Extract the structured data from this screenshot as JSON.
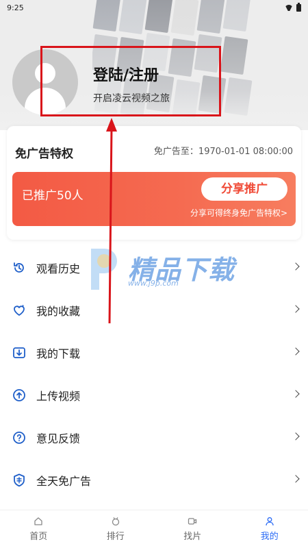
{
  "status_bar": {
    "time": "9:25"
  },
  "profile": {
    "title": "登陆/注册",
    "subtitle": "开启凌云视频之旅"
  },
  "ad_privilege": {
    "title": "免广告特权",
    "expiry_label": "免广告至：1970-01-01 08:00:00",
    "promoted_count": "已推广50人",
    "share_button": "分享推广",
    "share_hint": "分享可得终身免广告特权>"
  },
  "menu": {
    "items": [
      {
        "label": "观看历史",
        "icon": "history-icon"
      },
      {
        "label": "我的收藏",
        "icon": "heart-icon"
      },
      {
        "label": "我的下载",
        "icon": "download-icon"
      },
      {
        "label": "上传视频",
        "icon": "upload-icon"
      },
      {
        "label": "意见反馈",
        "icon": "feedback-icon"
      },
      {
        "label": "全天免广告",
        "icon": "no-ad-icon"
      }
    ]
  },
  "watermark": {
    "text": "精品下载",
    "url": "www.j9p.com"
  },
  "tab_bar": {
    "active": "我的",
    "tabs": [
      {
        "label": "首页",
        "icon": "home-icon"
      },
      {
        "label": "排行",
        "icon": "ranking-icon"
      },
      {
        "label": "找片",
        "icon": "find-video-icon"
      },
      {
        "label": "我的",
        "icon": "profile-icon"
      }
    ]
  },
  "colors": {
    "accent": "#2c6cf5",
    "promo_red": "#f35a44",
    "annotation_red": "#d9141a",
    "icon_blue": "#1f5fc9"
  }
}
